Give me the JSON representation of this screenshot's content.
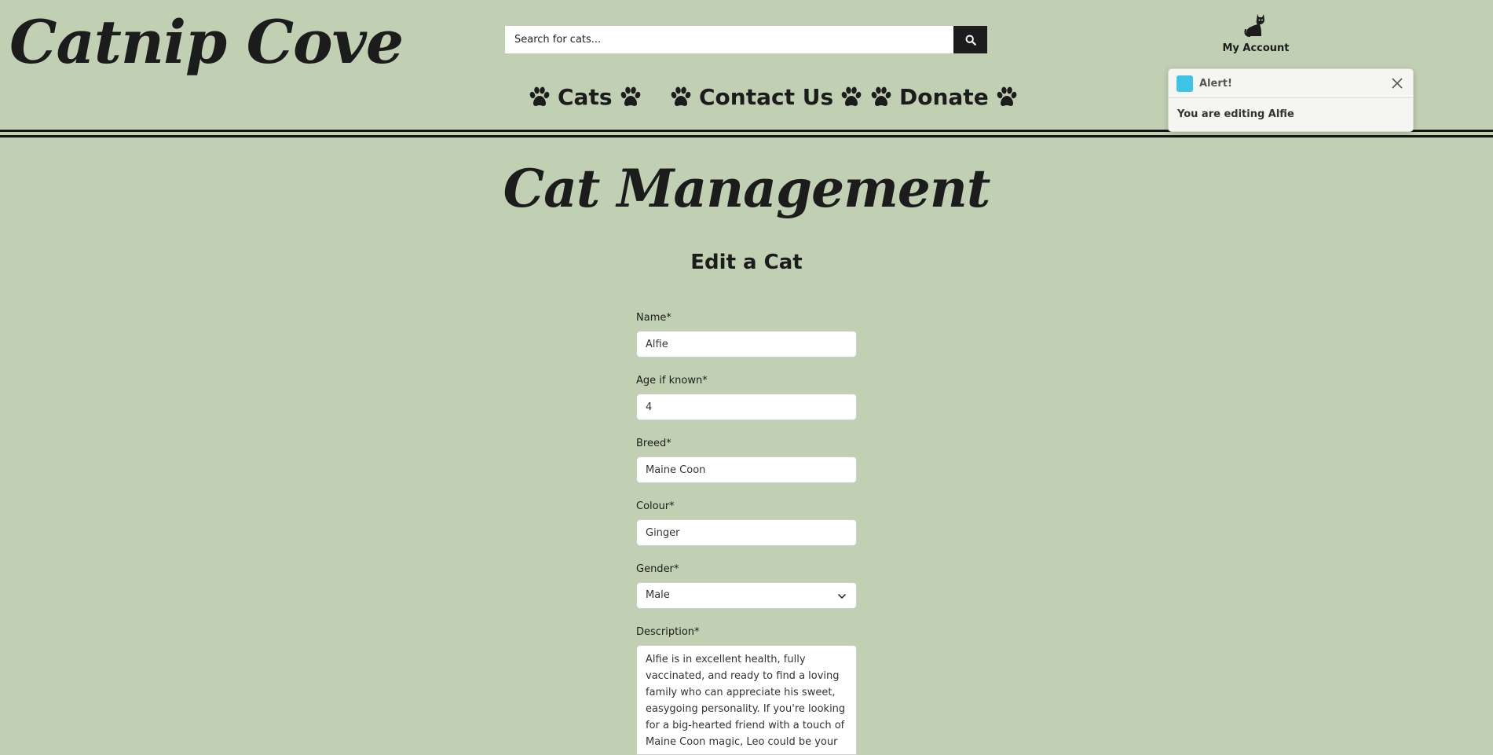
{
  "header": {
    "logo": "Catnip Cove",
    "search": {
      "placeholder": "Search for cats...",
      "button_icon": "search-icon"
    },
    "account": {
      "icon": "cat-icon",
      "label": "My Account"
    },
    "nav": [
      {
        "label": "Cats",
        "icon": "paw-icon"
      },
      {
        "label": "Contact Us",
        "icon": "paw-icon"
      },
      {
        "label": "Donate",
        "icon": "paw-icon"
      }
    ]
  },
  "toast": {
    "title": "Alert!",
    "message": "You are editing Alfie",
    "accent_color": "#3cc3e6",
    "close_icon": "close-icon"
  },
  "main": {
    "title": "Cat Management",
    "subtitle": "Edit a Cat",
    "form": {
      "name": {
        "label": "Name*",
        "value": "Alfie"
      },
      "age": {
        "label": "Age if known*",
        "value": "4"
      },
      "breed": {
        "label": "Breed*",
        "value": "Maine Coon"
      },
      "colour": {
        "label": "Colour*",
        "value": "Ginger"
      },
      "gender": {
        "label": "Gender*",
        "value": "Male",
        "icon": "chevron-down-icon"
      },
      "description": {
        "label": "Description*",
        "value": "Alfie is in excellent health, fully vaccinated, and ready to find a loving family who can appreciate his sweet, easygoing personality. If you're looking for a big-hearted friend with a touch of Maine Coon magic, Leo could be your"
      }
    }
  },
  "colors": {
    "background": "#c1cfb3",
    "text": "#1c1c1c",
    "toast_swatch": "#3cc3e6"
  }
}
